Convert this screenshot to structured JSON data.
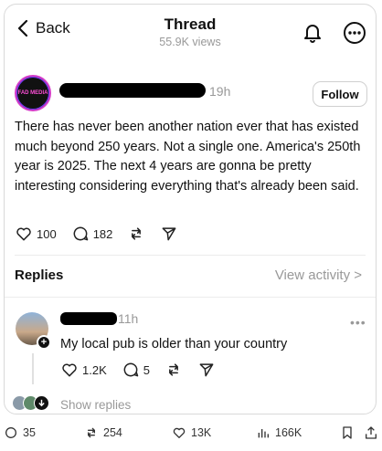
{
  "header": {
    "back_label": "Back",
    "title": "Thread",
    "views": "55.9K views"
  },
  "post": {
    "avatar_text": "FAD MEDIA",
    "time": "19h",
    "follow_label": "Follow",
    "text": "There has never been another nation ever that has existed much beyond 250 years. Not a single one. America's 250th year is 2025. The next 4 years are gonna be pretty interesting considering everything that's already been said.",
    "likes": "100",
    "replies": "182"
  },
  "replies_section": {
    "heading": "Replies",
    "view_activity": "View activity >"
  },
  "reply": {
    "time": "11h",
    "text": "My local pub is older than your country",
    "likes": "1.2K",
    "replies": "5",
    "show_replies": "Show replies"
  },
  "bottom_bar": {
    "replies": "35",
    "reposts": "254",
    "likes": "13K",
    "views": "166K"
  },
  "colors": {
    "accent_magenta": "#d43cc9",
    "muted": "#999999",
    "text": "#111111"
  }
}
